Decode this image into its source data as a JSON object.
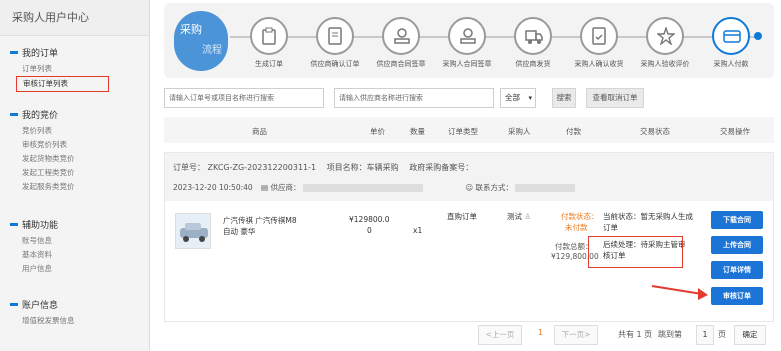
{
  "sidebar": {
    "title": "采购人用户中心",
    "sections": [
      {
        "title": "我的订单",
        "items": [
          "订单列表",
          "审核订单列表"
        ]
      },
      {
        "title": "我的竞价",
        "items": [
          "竞价列表",
          "审核竞价列表",
          "发起货物类竞价",
          "发起工程类竞价",
          "发起服务类竞价"
        ]
      },
      {
        "title": "辅助功能",
        "items": [
          "账号信息",
          "基本资料",
          "用户信息"
        ]
      },
      {
        "title": "账户信息",
        "items": [
          "增值税发票信息"
        ]
      }
    ]
  },
  "flow": {
    "badge_top": "采购",
    "badge_bottom": "流程",
    "steps": [
      "生成订单",
      "供应商确认订单",
      "供应商合同签章",
      "采购人合同签章",
      "供应商发货",
      "采购人确认收货",
      "采购人验收评价",
      "采购人付款"
    ]
  },
  "filters": {
    "order_placeholder": "请输入订单号或项目名称进行搜索",
    "supplier_placeholder": "请输入供应商名称进行搜索",
    "status_value": "全部",
    "search_label": "搜索",
    "cancelled_label": "查看取消订单"
  },
  "table_headers": [
    "商品",
    "单价",
    "数量",
    "订单类型",
    "采购人",
    "付款",
    "交易状态",
    "交易操作"
  ],
  "order": {
    "order_no": "订单号：  ZKCG-ZG-202312200311-1",
    "project": "项目名称：车辆采购",
    "gov_no": "政府采购备案号：",
    "time": "2023-12-20 10:50:40",
    "supplier": "供应商：",
    "contact": "联系方式：",
    "product": "广汽传祺 广汽传祺M8 自动 豪华",
    "price": "¥129800.0",
    "price_sub": "0",
    "qty": "x1",
    "order_type": "直购订单",
    "buyer": "测试",
    "pay_status": "付款状态：",
    "pay_value": "未付款",
    "pay_total_label": "付款总额：",
    "pay_total": "¥129,800.00",
    "cur_status": "当前状态：暂无采购人生成订单",
    "next_step": "后续处理：待采购主管审核订单",
    "btn_download": "下载合同",
    "btn_upload": "上传合同",
    "btn_detail": "订单详情",
    "btn_review": "审核订单"
  },
  "pager": {
    "prev": "<上一页",
    "current": "1",
    "next": "下一页>",
    "total": "共有 1 页",
    "goto": "跳到第",
    "page_input": "1",
    "page_unit": "页",
    "confirm": "确定"
  },
  "colors": {
    "accent": "#1c74d6",
    "highlight": "#e23b2e",
    "warn": "#e6781e"
  }
}
